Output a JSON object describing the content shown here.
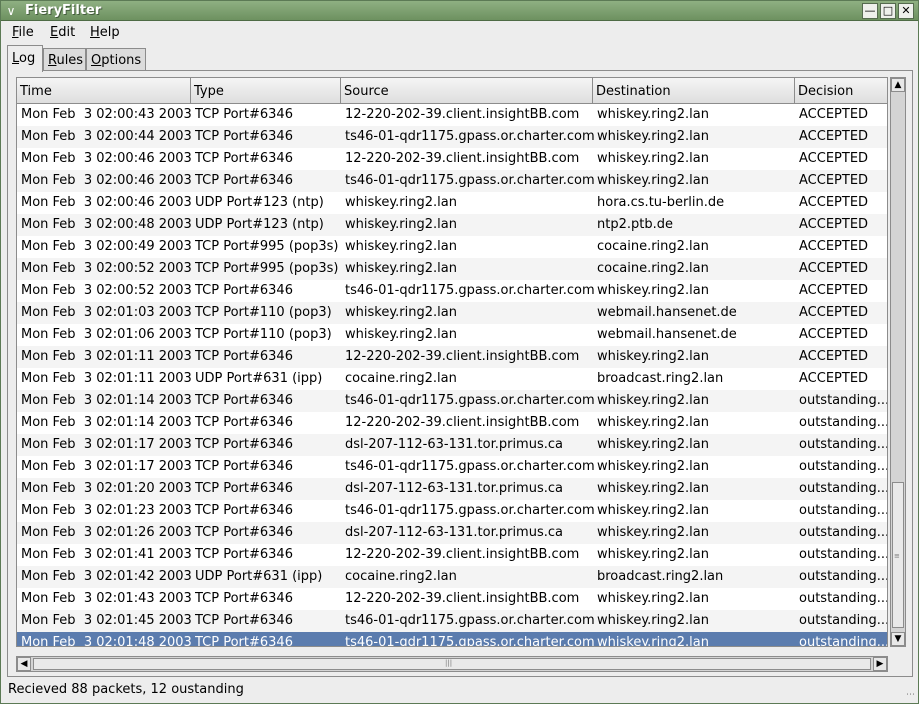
{
  "window": {
    "title": "FieryFilter"
  },
  "menu": [
    {
      "label": "File",
      "accel": "F",
      "rest": "ile"
    },
    {
      "label": "Edit",
      "accel": "E",
      "rest": "dit"
    },
    {
      "label": "Help",
      "accel": "H",
      "rest": "elp"
    }
  ],
  "tabs": [
    {
      "label": "Log",
      "accel": "L",
      "rest": "og",
      "active": true
    },
    {
      "label": "Rules",
      "accel": "R",
      "rest": "ules",
      "active": false
    },
    {
      "label": "Options",
      "accel": "O",
      "rest": "ptions",
      "active": false
    }
  ],
  "table": {
    "columns": [
      "Time",
      "Type",
      "Source",
      "Destination",
      "Decision"
    ],
    "rows": [
      [
        "Mon Feb  3 02:00:43 2003",
        "TCP Port#6346",
        "12-220-202-39.client.insightBB.com",
        "whiskey.ring2.lan",
        "ACCEPTED"
      ],
      [
        "Mon Feb  3 02:00:44 2003",
        "TCP Port#6346",
        "ts46-01-qdr1175.gpass.or.charter.com",
        "whiskey.ring2.lan",
        "ACCEPTED"
      ],
      [
        "Mon Feb  3 02:00:46 2003",
        "TCP Port#6346",
        "12-220-202-39.client.insightBB.com",
        "whiskey.ring2.lan",
        "ACCEPTED"
      ],
      [
        "Mon Feb  3 02:00:46 2003",
        "TCP Port#6346",
        "ts46-01-qdr1175.gpass.or.charter.com",
        "whiskey.ring2.lan",
        "ACCEPTED"
      ],
      [
        "Mon Feb  3 02:00:46 2003",
        "UDP Port#123 (ntp)",
        "whiskey.ring2.lan",
        "hora.cs.tu-berlin.de",
        "ACCEPTED"
      ],
      [
        "Mon Feb  3 02:00:48 2003",
        "UDP Port#123 (ntp)",
        "whiskey.ring2.lan",
        "ntp2.ptb.de",
        "ACCEPTED"
      ],
      [
        "Mon Feb  3 02:00:49 2003",
        "TCP Port#995 (pop3s)",
        "whiskey.ring2.lan",
        "cocaine.ring2.lan",
        "ACCEPTED"
      ],
      [
        "Mon Feb  3 02:00:52 2003",
        "TCP Port#995 (pop3s)",
        "whiskey.ring2.lan",
        "cocaine.ring2.lan",
        "ACCEPTED"
      ],
      [
        "Mon Feb  3 02:00:52 2003",
        "TCP Port#6346",
        "ts46-01-qdr1175.gpass.or.charter.com",
        "whiskey.ring2.lan",
        "ACCEPTED"
      ],
      [
        "Mon Feb  3 02:01:03 2003",
        "TCP Port#110 (pop3)",
        "whiskey.ring2.lan",
        "webmail.hansenet.de",
        "ACCEPTED"
      ],
      [
        "Mon Feb  3 02:01:06 2003",
        "TCP Port#110 (pop3)",
        "whiskey.ring2.lan",
        "webmail.hansenet.de",
        "ACCEPTED"
      ],
      [
        "Mon Feb  3 02:01:11 2003",
        "TCP Port#6346",
        "12-220-202-39.client.insightBB.com",
        "whiskey.ring2.lan",
        "ACCEPTED"
      ],
      [
        "Mon Feb  3 02:01:11 2003",
        "UDP Port#631 (ipp)",
        "cocaine.ring2.lan",
        "broadcast.ring2.lan",
        "ACCEPTED"
      ],
      [
        "Mon Feb  3 02:01:14 2003",
        "TCP Port#6346",
        "ts46-01-qdr1175.gpass.or.charter.com",
        "whiskey.ring2.lan",
        "outstanding..."
      ],
      [
        "Mon Feb  3 02:01:14 2003",
        "TCP Port#6346",
        "12-220-202-39.client.insightBB.com",
        "whiskey.ring2.lan",
        "outstanding..."
      ],
      [
        "Mon Feb  3 02:01:17 2003",
        "TCP Port#6346",
        "dsl-207-112-63-131.tor.primus.ca",
        "whiskey.ring2.lan",
        "outstanding..."
      ],
      [
        "Mon Feb  3 02:01:17 2003",
        "TCP Port#6346",
        "ts46-01-qdr1175.gpass.or.charter.com",
        "whiskey.ring2.lan",
        "outstanding..."
      ],
      [
        "Mon Feb  3 02:01:20 2003",
        "TCP Port#6346",
        "dsl-207-112-63-131.tor.primus.ca",
        "whiskey.ring2.lan",
        "outstanding..."
      ],
      [
        "Mon Feb  3 02:01:23 2003",
        "TCP Port#6346",
        "ts46-01-qdr1175.gpass.or.charter.com",
        "whiskey.ring2.lan",
        "outstanding..."
      ],
      [
        "Mon Feb  3 02:01:26 2003",
        "TCP Port#6346",
        "dsl-207-112-63-131.tor.primus.ca",
        "whiskey.ring2.lan",
        "outstanding..."
      ],
      [
        "Mon Feb  3 02:01:41 2003",
        "TCP Port#6346",
        "12-220-202-39.client.insightBB.com",
        "whiskey.ring2.lan",
        "outstanding..."
      ],
      [
        "Mon Feb  3 02:01:42 2003",
        "UDP Port#631 (ipp)",
        "cocaine.ring2.lan",
        "broadcast.ring2.lan",
        "outstanding..."
      ],
      [
        "Mon Feb  3 02:01:43 2003",
        "TCP Port#6346",
        "12-220-202-39.client.insightBB.com",
        "whiskey.ring2.lan",
        "outstanding..."
      ],
      [
        "Mon Feb  3 02:01:45 2003",
        "TCP Port#6346",
        "ts46-01-qdr1175.gpass.or.charter.com",
        "whiskey.ring2.lan",
        "outstanding..."
      ],
      [
        "Mon Feb  3 02:01:48 2003",
        "TCP Port#6346",
        "ts46-01-qdr1175.gpass.or.charter.com",
        "whiskey.ring2.lan",
        "outstanding..."
      ]
    ],
    "selected_row": 24
  },
  "status": {
    "text": "Recieved 88 packets, 12 oustanding"
  },
  "colors": {
    "titlebar": "#7a9c6d",
    "selection": "#5b7cae",
    "background": "#ededed"
  },
  "icons": {
    "window_menu": "chevron-down-icon",
    "minimize": "minimize-icon",
    "maximize": "maximize-icon",
    "close": "close-icon"
  }
}
